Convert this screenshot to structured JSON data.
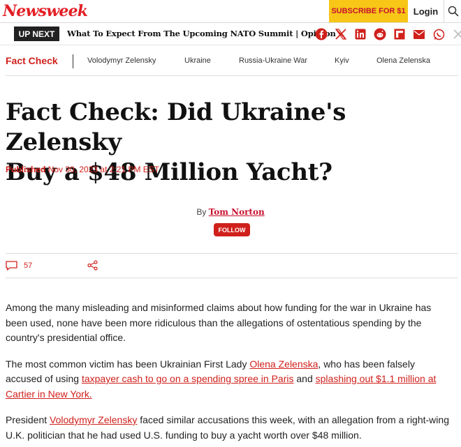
{
  "header": {
    "logo": "Newsweek",
    "subscribe_label": "SUBSCRIBE FOR $1",
    "login_label": "Login"
  },
  "upnext": {
    "label": "UP NEXT",
    "title": "What To Expect From The Upcoming NATO Summit | Opinion"
  },
  "share_icons": [
    "facebook-icon",
    "x-icon",
    "linkedin-icon",
    "reddit-icon",
    "flipboard-icon",
    "email-icon",
    "whatsapp-icon",
    "close-icon"
  ],
  "section": {
    "main": "Fact Check",
    "tags": [
      "Volodymyr Zelensky",
      "Ukraine",
      "Russia-Ukraine War",
      "Kyiv",
      "Olena Zelenska"
    ]
  },
  "article": {
    "headline_line1": "Fact Check: Did Ukraine's Zelensky",
    "headline_line2": "Buy a $48 Million Yacht?",
    "published_label": "Published",
    "published_date": "Nov 30, 2023 at 2:21 PM EST",
    "by_label": "By",
    "author": "Tom Norton",
    "follow_label": "FOLLOW",
    "comment_count": "57",
    "p1": "Among the many misleading and misinformed claims about how funding for the war in Ukraine has been used, none have been more ridiculous than the allegations of ostentatious spending by the country's presidential office.",
    "p2_a": "The most common victim has been Ukrainian First Lady ",
    "p2_link1": "Olena Zelenska",
    "p2_b": ", who has been falsely accused of using ",
    "p2_link2": "taxpayer cash to go on a spending spree in Paris",
    "p2_c": " and ",
    "p2_link3": "splashing out $1.1 million at Cartier in New York.",
    "p3_a": "President ",
    "p3_link1": "Volodymyr Zelensky",
    "p3_b": " faced similar accusations this week, with an allegation from a right-wing U.K. politician that he had used U.S. funding to buy a yacht worth over $48 million."
  },
  "colors": {
    "brand_red": "#e31e24",
    "link_red": "#d0201b",
    "subscribe_yellow": "#f7c617"
  }
}
